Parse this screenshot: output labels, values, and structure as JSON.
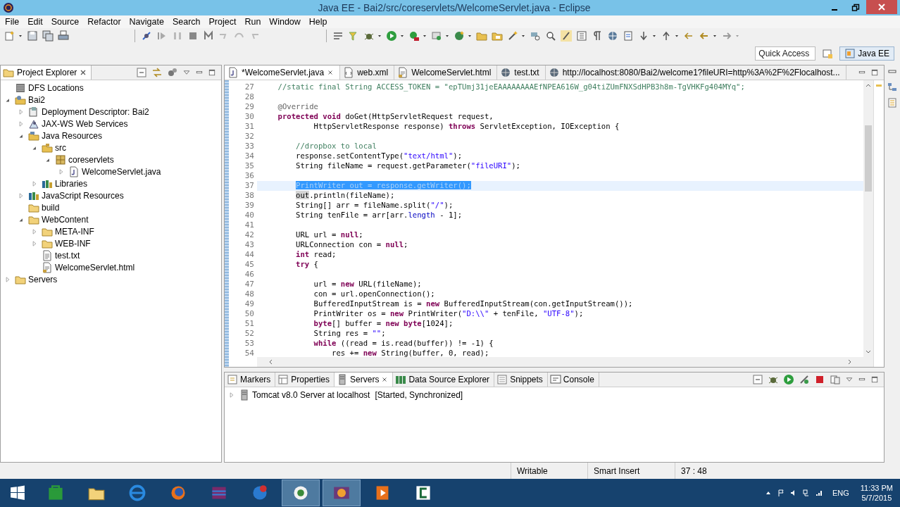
{
  "window": {
    "title": "Java EE - Bai2/src/coreservlets/WelcomeServlet.java - Eclipse"
  },
  "menu": [
    "File",
    "Edit",
    "Source",
    "Refactor",
    "Navigate",
    "Search",
    "Project",
    "Run",
    "Window",
    "Help"
  ],
  "quick_access": {
    "placeholder": "Quick Access"
  },
  "perspective": {
    "label": "Java EE",
    "selected": true
  },
  "project_explorer": {
    "title": "Project Explorer",
    "tree": [
      {
        "label": "DFS Locations",
        "kind": "dfs"
      },
      {
        "label": "Bai2",
        "kind": "project",
        "expanded": true,
        "children": [
          {
            "label": "Deployment Descriptor: Bai2",
            "kind": "descriptor",
            "expanded": false
          },
          {
            "label": "JAX-WS Web Services",
            "kind": "service",
            "expanded": false
          },
          {
            "label": "Java Resources",
            "kind": "resources",
            "expanded": true,
            "children": [
              {
                "label": "src",
                "kind": "source",
                "expanded": true,
                "children": [
                  {
                    "label": "coreservlets",
                    "kind": "package",
                    "expanded": true,
                    "children": [
                      {
                        "label": "WelcomeServlet.java",
                        "kind": "java",
                        "expanded": false
                      }
                    ]
                  }
                ]
              },
              {
                "label": "Libraries",
                "kind": "library",
                "expanded": false
              }
            ]
          },
          {
            "label": "JavaScript Resources",
            "kind": "library",
            "expanded": false
          },
          {
            "label": "build",
            "kind": "folder"
          },
          {
            "label": "WebContent",
            "kind": "folder",
            "expanded": true,
            "children": [
              {
                "label": "META-INF",
                "kind": "folder",
                "expanded": false
              },
              {
                "label": "WEB-INF",
                "kind": "folder",
                "expanded": false
              },
              {
                "label": "test.txt",
                "kind": "text"
              },
              {
                "label": "WelcomeServlet.html",
                "kind": "html"
              }
            ]
          }
        ]
      },
      {
        "label": "Servers",
        "kind": "folder",
        "expanded": false
      }
    ]
  },
  "editor": {
    "tabs": [
      {
        "label": "*WelcomeServlet.java",
        "kind": "java",
        "selected": true
      },
      {
        "label": "web.xml",
        "kind": "xml",
        "selected": false
      },
      {
        "label": "WelcomeServlet.html",
        "kind": "html",
        "selected": false
      },
      {
        "label": "test.txt",
        "kind": "web",
        "selected": false
      },
      {
        "label": "http://localhost:8080/Bai2/welcome1?fileURI=http%3A%2F%2Flocalhost...",
        "kind": "web",
        "selected": false
      }
    ],
    "lines": [
      {
        "number": "27",
        "current": false,
        "tokens": [
          {
            "kind": "comment",
            "text": "    //static final String ACCESS_TOKEN = \"epTUmj31jeEAAAAAAAAEfNPEA616W_g04tiZUmFNXSdHPB3h8m-TgVHKFg404MYq\";"
          }
        ]
      },
      {
        "number": "28",
        "current": false
      },
      {
        "number": "29",
        "current": false,
        "tokens": [
          {
            "kind": "ann",
            "text": "    @Override"
          }
        ]
      },
      {
        "number": "30",
        "current": false,
        "tokens": [
          {
            "kind": "kw",
            "text": "    protected void"
          },
          {
            "kind": "plain",
            "text": " doGet(HttpServletRequest request,"
          }
        ]
      },
      {
        "number": "31",
        "current": false,
        "tokens": [
          {
            "kind": "plain",
            "text": "            HttpServletResponse response) "
          },
          {
            "kind": "kw",
            "text": "throws"
          },
          {
            "kind": "plain",
            "text": " ServletException, IOException {"
          }
        ]
      },
      {
        "number": "32",
        "current": false
      },
      {
        "number": "33",
        "current": false,
        "tokens": [
          {
            "kind": "comment",
            "text": "        //dropbox to local"
          }
        ]
      },
      {
        "number": "34",
        "current": false,
        "tokens": [
          {
            "kind": "plain",
            "text": "        response.setContentType("
          },
          {
            "kind": "str",
            "text": "\"text/html\""
          },
          {
            "kind": "plain",
            "text": ");"
          }
        ]
      },
      {
        "number": "35",
        "current": false,
        "tokens": [
          {
            "kind": "plain",
            "text": "        String fileName = request.getParameter("
          },
          {
            "kind": "str",
            "text": "\"fileURI\""
          },
          {
            "kind": "plain",
            "text": ");"
          }
        ]
      },
      {
        "number": "36",
        "current": false
      },
      {
        "number": "37",
        "current": true,
        "tokens": [
          {
            "kind": "selection",
            "text": "        PrintWriter out = response.getWriter();"
          }
        ]
      },
      {
        "number": "38",
        "current": false,
        "tokens": [
          {
            "kind": "occurrence",
            "text": "        out"
          },
          {
            "kind": "plain",
            "text": ".println(fileName);"
          }
        ]
      },
      {
        "number": "39",
        "current": false,
        "tokens": [
          {
            "kind": "plain",
            "text": "        String[] arr = fileName.split("
          },
          {
            "kind": "str",
            "text": "\"/\""
          },
          {
            "kind": "plain",
            "text": ");"
          }
        ]
      },
      {
        "number": "40",
        "current": false,
        "tokens": [
          {
            "kind": "plain",
            "text": "        String tenFile = arr[arr."
          },
          {
            "kind": "field",
            "text": "length"
          },
          {
            "kind": "plain",
            "text": " - 1];"
          }
        ]
      },
      {
        "number": "41",
        "current": false
      },
      {
        "number": "42",
        "current": false,
        "tokens": [
          {
            "kind": "plain",
            "text": "        URL url = "
          },
          {
            "kind": "kw",
            "text": "null"
          },
          {
            "kind": "plain",
            "text": ";"
          }
        ]
      },
      {
        "number": "43",
        "current": false,
        "tokens": [
          {
            "kind": "plain",
            "text": "        URLConnection con = "
          },
          {
            "kind": "kw",
            "text": "null"
          },
          {
            "kind": "plain",
            "text": ";"
          }
        ]
      },
      {
        "number": "44",
        "current": false,
        "tokens": [
          {
            "kind": "kw",
            "text": "        int"
          },
          {
            "kind": "plain",
            "text": " read;"
          }
        ]
      },
      {
        "number": "45",
        "current": false,
        "tokens": [
          {
            "kind": "kw",
            "text": "        try"
          },
          {
            "kind": "plain",
            "text": " {"
          }
        ]
      },
      {
        "number": "46",
        "current": false
      },
      {
        "number": "47",
        "current": false,
        "tokens": [
          {
            "kind": "plain",
            "text": "            url = "
          },
          {
            "kind": "kw",
            "text": "new"
          },
          {
            "kind": "plain",
            "text": " URL(fileName);"
          }
        ]
      },
      {
        "number": "48",
        "current": false,
        "tokens": [
          {
            "kind": "plain",
            "text": "            con = url.openConnection();"
          }
        ]
      },
      {
        "number": "49",
        "current": false,
        "tokens": [
          {
            "kind": "plain",
            "text": "            BufferedInputStream is = "
          },
          {
            "kind": "kw",
            "text": "new"
          },
          {
            "kind": "plain",
            "text": " BufferedInputStream(con.getInputStream());"
          }
        ]
      },
      {
        "number": "50",
        "current": false,
        "tokens": [
          {
            "kind": "plain",
            "text": "            PrintWriter os = "
          },
          {
            "kind": "kw",
            "text": "new"
          },
          {
            "kind": "plain",
            "text": " PrintWriter("
          },
          {
            "kind": "str",
            "text": "\"D:\\\\\""
          },
          {
            "kind": "plain",
            "text": " + tenFile, "
          },
          {
            "kind": "str",
            "text": "\"UTF-8\""
          },
          {
            "kind": "plain",
            "text": ");"
          }
        ]
      },
      {
        "number": "51",
        "current": false,
        "tokens": [
          {
            "kind": "kw",
            "text": "            byte"
          },
          {
            "kind": "plain",
            "text": "[] buffer = "
          },
          {
            "kind": "kw",
            "text": "new byte"
          },
          {
            "kind": "plain",
            "text": "[1024];"
          }
        ]
      },
      {
        "number": "52",
        "current": false,
        "tokens": [
          {
            "kind": "plain",
            "text": "            String res = "
          },
          {
            "kind": "str",
            "text": "\"\""
          },
          {
            "kind": "plain",
            "text": ";"
          }
        ]
      },
      {
        "number": "53",
        "current": false,
        "tokens": [
          {
            "kind": "kw",
            "text": "            while"
          },
          {
            "kind": "plain",
            "text": " ((read = is.read(buffer)) != -1) {"
          }
        ]
      },
      {
        "number": "54",
        "current": false,
        "tokens": [
          {
            "kind": "plain",
            "text": "                res += "
          },
          {
            "kind": "kw",
            "text": "new"
          },
          {
            "kind": "plain",
            "text": " String(buffer, 0, read);"
          }
        ]
      }
    ]
  },
  "bottom_panel": {
    "tabs": [
      {
        "label": "Markers",
        "selected": false
      },
      {
        "label": "Properties",
        "selected": false
      },
      {
        "label": "Servers",
        "selected": true
      },
      {
        "label": "Data Source Explorer",
        "selected": false
      },
      {
        "label": "Snippets",
        "selected": false
      },
      {
        "label": "Console",
        "selected": false
      }
    ],
    "servers": [
      {
        "name": "Tomcat v8.0 Server at localhost",
        "state": "[Started, Synchronized]",
        "expanded": false
      }
    ]
  },
  "status_bar": [
    "Writable",
    "Smart Insert",
    "37 : 48"
  ],
  "taskbar": {
    "language": "ENG",
    "time": "11:33 PM",
    "date": "5/7/2015"
  }
}
